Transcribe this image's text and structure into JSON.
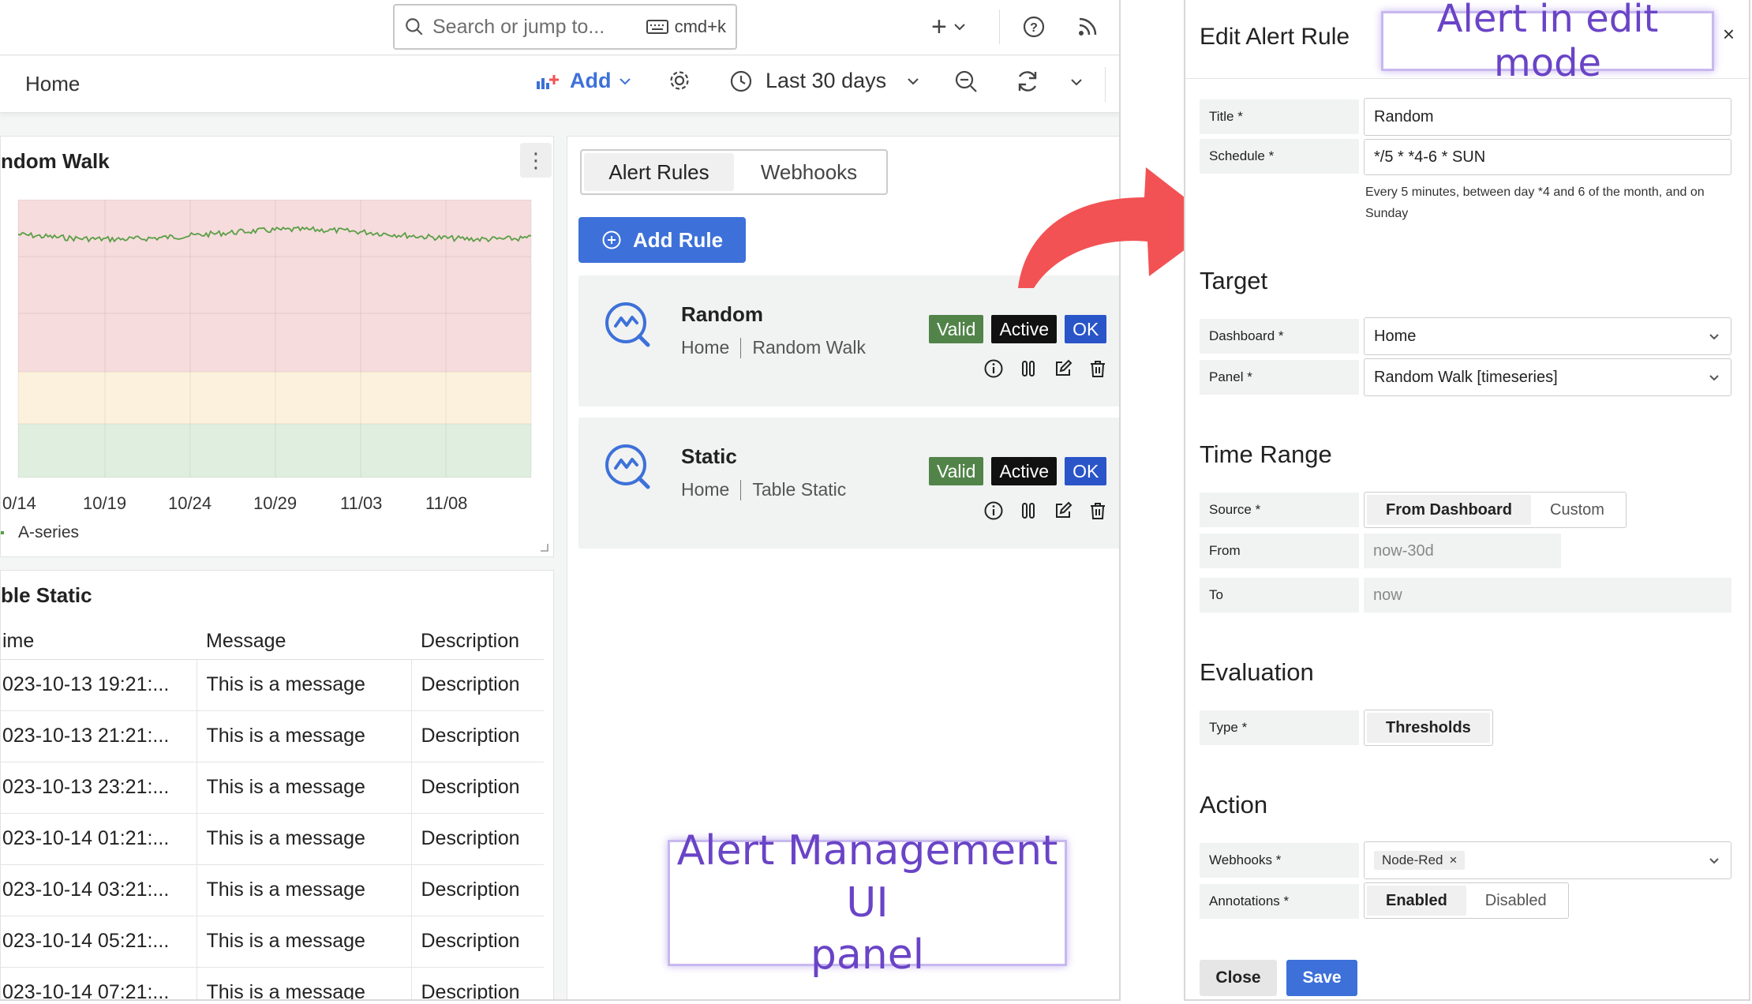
{
  "topbar": {
    "search_placeholder": "Search or jump to...",
    "search_shortcut": "cmd+k",
    "icons": [
      "plus-icon",
      "chevron-down-icon",
      "help-icon",
      "rss-icon"
    ]
  },
  "toolbar": {
    "breadcrumb": "Home",
    "add_label": "Add",
    "time_range": "Last 30 days"
  },
  "chart_panel": {
    "title": "ndom Walk",
    "legend": "A-series",
    "chart_data": {
      "type": "line",
      "x_ticks": [
        "0/14",
        "10/19",
        "10/24",
        "10/29",
        "11/03",
        "11/08"
      ],
      "series": [
        {
          "name": "A-series",
          "color": "#5a9e46"
        }
      ],
      "threshold_bands": [
        {
          "color": "#f6dcdc"
        },
        {
          "color": "#fbf1dc"
        },
        {
          "color": "#e0eee0"
        }
      ],
      "grid": true,
      "legend_placement": "bottom-left"
    }
  },
  "table_panel": {
    "title": "ble Static",
    "columns": [
      "ime",
      "Message",
      "Description"
    ],
    "rows": [
      [
        "023-10-13 19:21:...",
        "This is a message",
        "Description"
      ],
      [
        "023-10-13 21:21:...",
        "This is a message",
        "Description"
      ],
      [
        "023-10-13 23:21:...",
        "This is a message",
        "Description"
      ],
      [
        "023-10-14 01:21:...",
        "This is a message",
        "Description"
      ],
      [
        "023-10-14 03:21:...",
        "This is a message",
        "Description"
      ],
      [
        "023-10-14 05:21:...",
        "This is a message",
        "Description"
      ],
      [
        "023-10-14 07:21:...",
        "This is a message",
        "Description"
      ]
    ]
  },
  "alert_panel": {
    "tabs": [
      "Alert Rules",
      "Webhooks"
    ],
    "add_rule": "Add Rule",
    "rules": [
      {
        "name": "Random",
        "dashboard": "Home",
        "panel": "Random Walk",
        "badges": [
          "Valid",
          "Active",
          "OK"
        ]
      },
      {
        "name": "Static",
        "dashboard": "Home",
        "panel": "Table Static",
        "badges": [
          "Valid",
          "Active",
          "OK"
        ]
      }
    ],
    "badge_colors": {
      "Valid": "#52844a",
      "Active": "#111111",
      "OK": "#2a55c8"
    }
  },
  "callouts": {
    "edit_mode": "Alert in edit mode",
    "panel_line1": "Alert Management UI",
    "panel_line2": "panel"
  },
  "drawer": {
    "title": "Edit Alert Rule",
    "close_icon": "×",
    "title_label": "Title *",
    "title_value": "Random",
    "schedule_label": "Schedule *",
    "schedule_value": "*/5 * *4-6 * SUN",
    "schedule_help": "Every 5 minutes, between day *4 and 6 of the month, and on Sunday",
    "target_heading": "Target",
    "dashboard_label": "Dashboard *",
    "dashboard_value": "Home",
    "panel_label": "Panel *",
    "panel_value": "Random Walk [timeseries]",
    "time_range_heading": "Time Range",
    "source_label": "Source *",
    "source_options": [
      "From Dashboard",
      "Custom"
    ],
    "from_label": "From",
    "from_value": "now-30d",
    "to_label": "To",
    "to_value": "now",
    "evaluation_heading": "Evaluation",
    "type_label": "Type *",
    "type_value": "Thresholds",
    "action_heading": "Action",
    "webhooks_label": "Webhooks *",
    "webhook_chip": "Node-Red",
    "annotations_label": "Annotations *",
    "annotation_options": [
      "Enabled",
      "Disabled"
    ],
    "close_button": "Close",
    "save_button": "Save"
  },
  "accent": {
    "arrow": "#f25254",
    "primary": "#3d71d9",
    "callout_text": "#6a44c6"
  }
}
